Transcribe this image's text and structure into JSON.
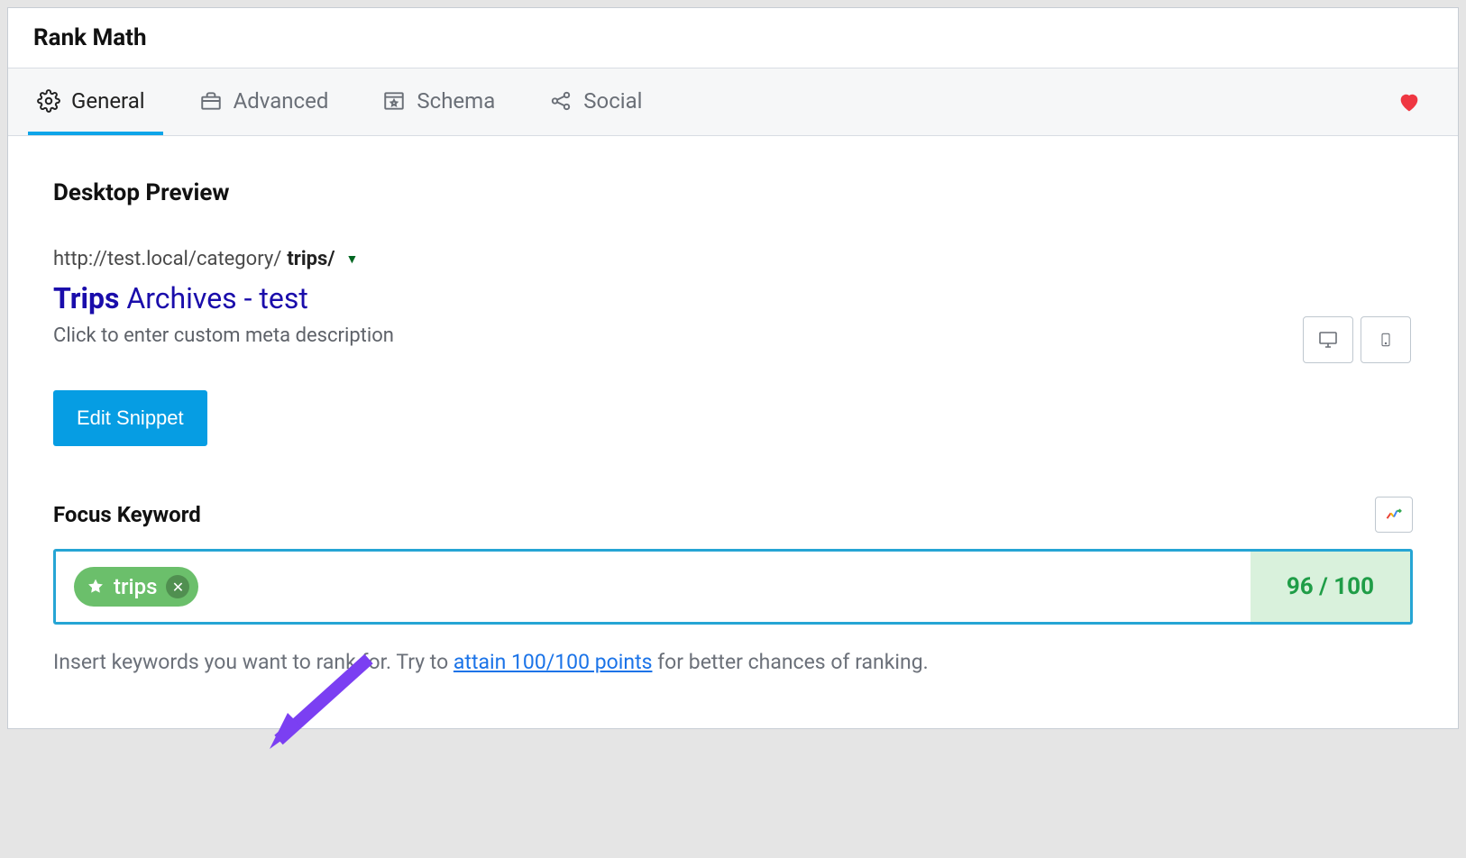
{
  "header": {
    "title": "Rank Math"
  },
  "tabs": [
    {
      "label": "General",
      "icon": "gear-icon",
      "active": true
    },
    {
      "label": "Advanced",
      "icon": "toolbox-icon",
      "active": false
    },
    {
      "label": "Schema",
      "icon": "window-star-icon",
      "active": false
    },
    {
      "label": "Social",
      "icon": "share-icon",
      "active": false
    }
  ],
  "heart": {
    "name": "favorite-icon"
  },
  "preview": {
    "section_title": "Desktop Preview",
    "url_plain": "http://test.local/category/",
    "url_bold": "trips/",
    "title_bold": "Trips",
    "title_rest": " Archives - test",
    "desc_placeholder": "Click to enter custom meta description",
    "edit_btn": "Edit Snippet"
  },
  "devices": {
    "desktop": "desktop-icon",
    "mobile": "mobile-icon"
  },
  "focus": {
    "title": "Focus Keyword",
    "keyword": "trips",
    "score_text": "96 / 100",
    "help_before": "Insert keywords you want to rank for. Try to ",
    "help_link": "attain 100/100 points",
    "help_after": " for better chances of ranking."
  }
}
